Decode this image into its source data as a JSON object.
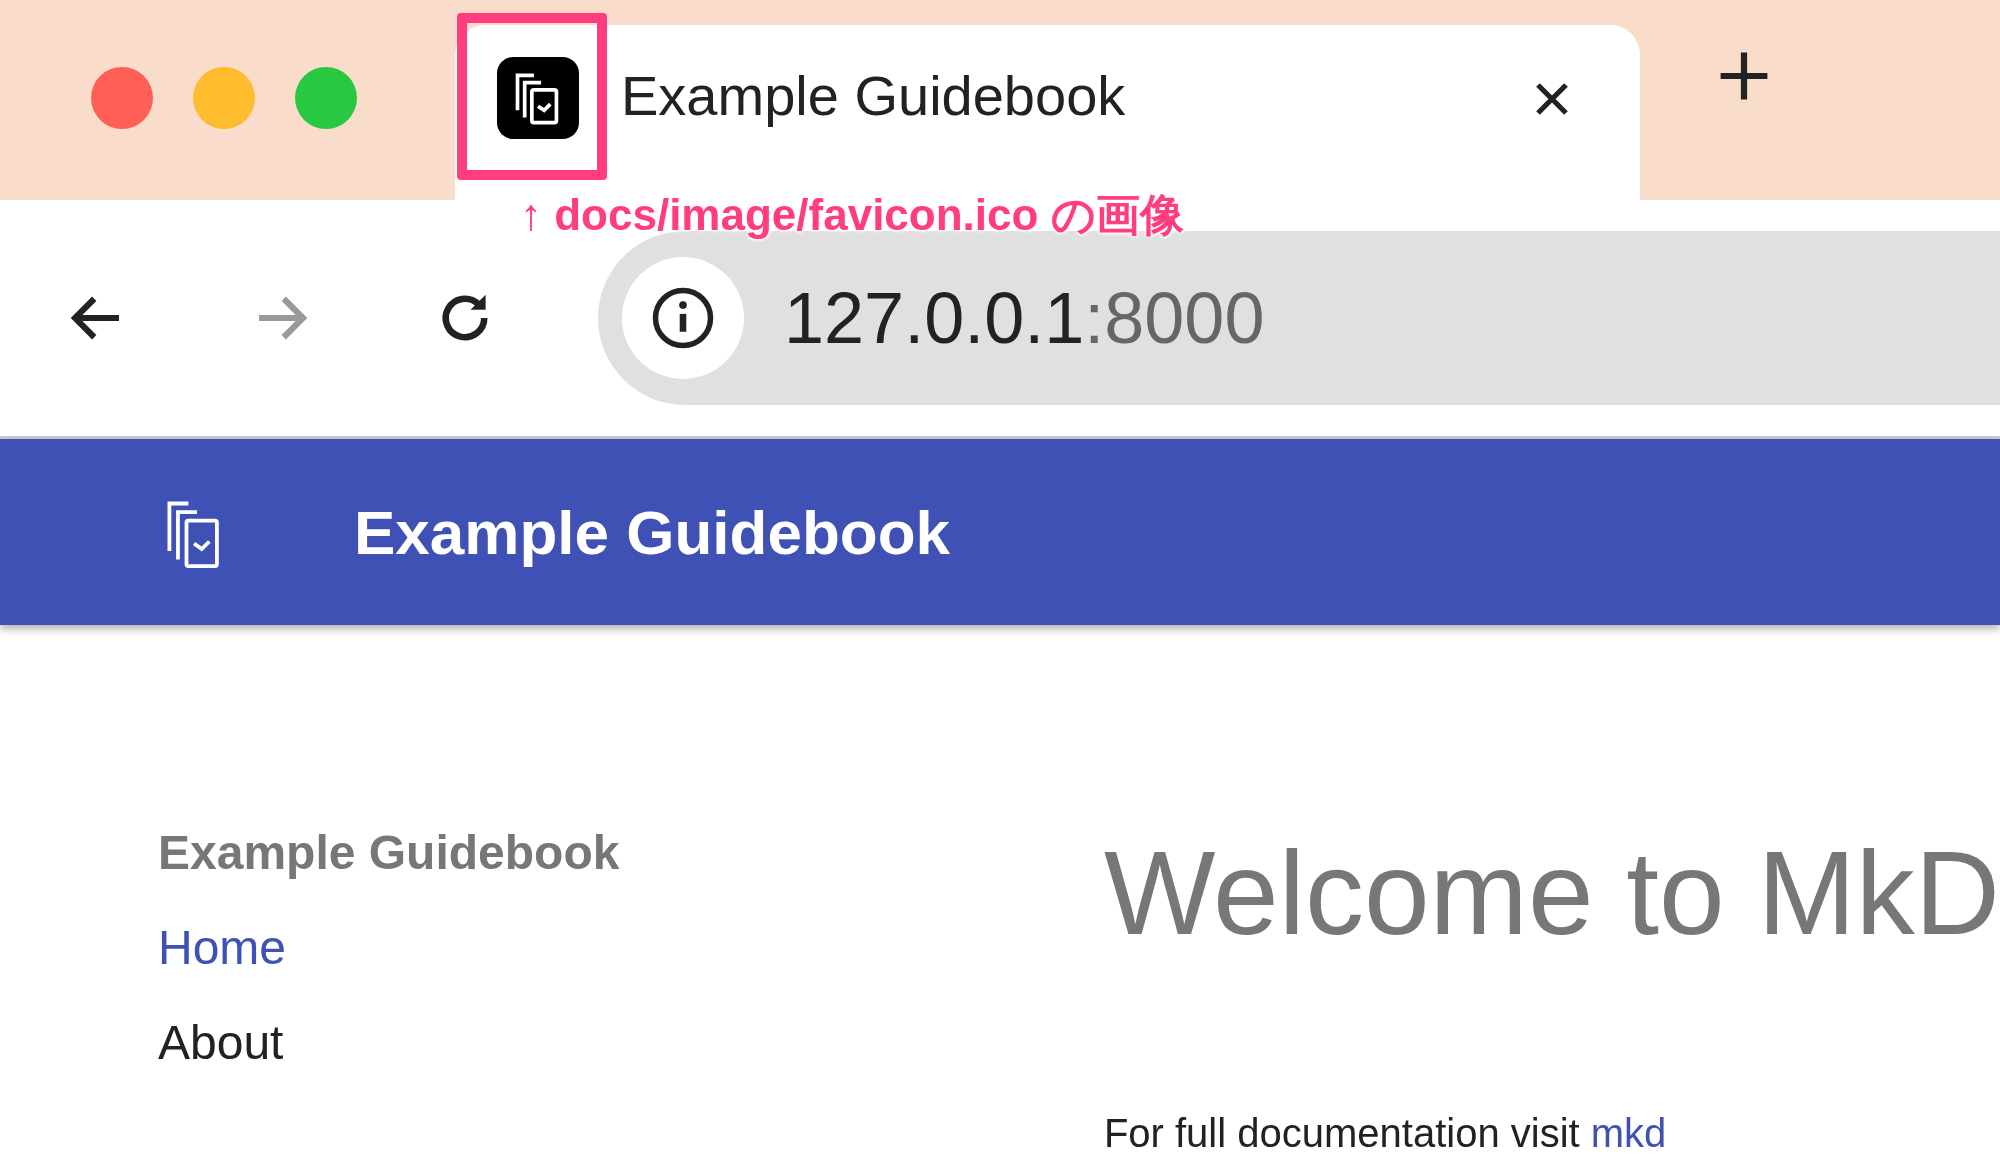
{
  "browser": {
    "tab": {
      "title": "Example Guidebook",
      "selected": true
    },
    "url": {
      "host": "127.0.0.1",
      "port": ":8000"
    },
    "forward_disabled": true
  },
  "annotation": {
    "arrow": "↑",
    "text": "docs/image/favicon.ico の画像"
  },
  "header": {
    "title": "Example Guidebook"
  },
  "sidebar": {
    "title": "Example Guidebook",
    "items": [
      {
        "label": "Home",
        "selected": true
      },
      {
        "label": "About",
        "selected": false
      }
    ]
  },
  "content": {
    "heading": "Welcome to MkD",
    "paragraph": "For full documentation visit",
    "link": "mkd"
  }
}
